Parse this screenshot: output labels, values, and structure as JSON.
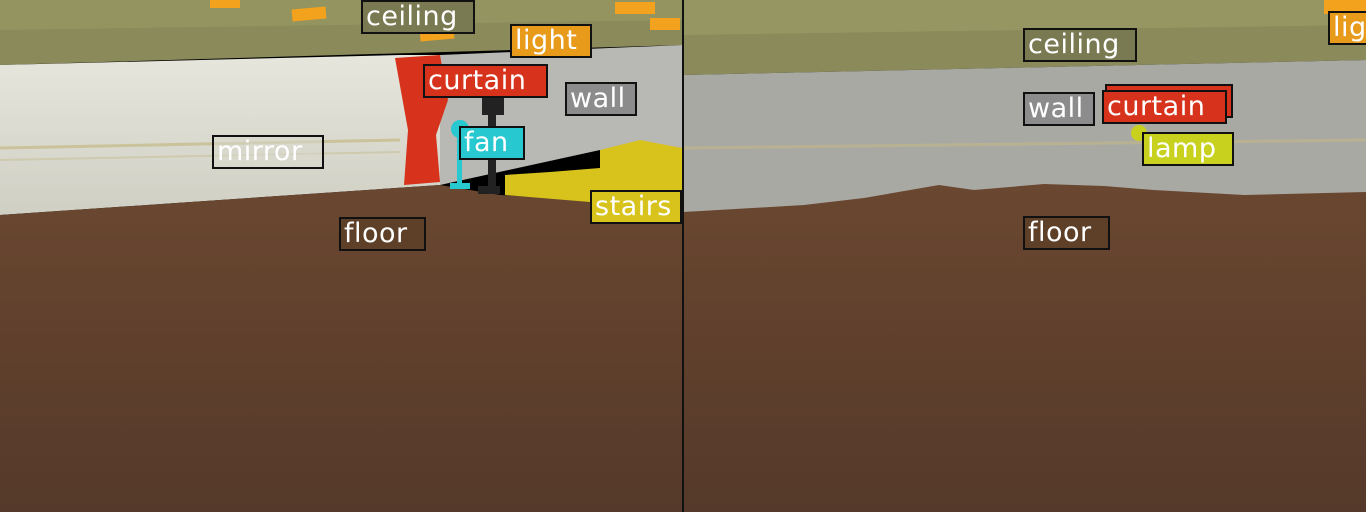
{
  "colors": {
    "ceiling": "#7a7a52",
    "wall": "#b9b9b5",
    "floor": "#5e4028",
    "curtain": "#d7321c",
    "light": "#e89a1a",
    "fan": "#27c8cf",
    "stairs": "#d8c21c",
    "lamp": "#c8d21e",
    "mirror": "#d8d8cc"
  },
  "left_panel": {
    "labels": {
      "ceiling": "ceiling",
      "light": "light",
      "curtain": "curtain",
      "wall": "wall",
      "fan": "fan",
      "mirror": "mirror",
      "stairs": "stairs",
      "floor": "floor"
    }
  },
  "right_panel": {
    "labels": {
      "ceiling": "ceiling",
      "light": "lig",
      "wall": "wall",
      "curtain": "curtain",
      "lamp": "lamp",
      "floor": "floor"
    }
  }
}
